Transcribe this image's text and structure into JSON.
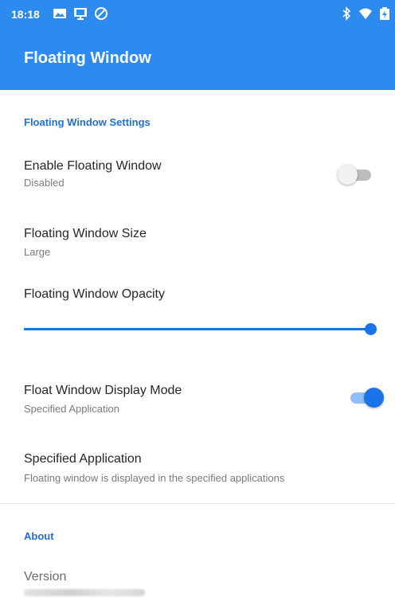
{
  "status_bar": {
    "time": "18:18",
    "left_icons": [
      "image-icon",
      "cast-icon",
      "sync-icon"
    ],
    "right_icons": [
      "bluetooth-icon",
      "wifi-icon",
      "battery-icon"
    ]
  },
  "toolbar": {
    "title": "Floating Window"
  },
  "sections": {
    "settings_title": "Floating Window Settings",
    "about_title": "About"
  },
  "prefs": {
    "enable": {
      "title": "Enable Floating Window",
      "summary": "Disabled",
      "checked": false
    },
    "size": {
      "title": "Floating Window Size",
      "summary": "Large"
    },
    "opacity": {
      "title": "Floating Window Opacity",
      "value_fraction": 0.99
    },
    "display_mode": {
      "title": "Float Window Display Mode",
      "summary": "Specified Application",
      "checked": true
    },
    "specified_app": {
      "title": "Specified Application",
      "summary": "Floating window is displayed in the specified applications"
    },
    "version": {
      "title": "Version"
    }
  },
  "colors": {
    "primary": "#2d8bf0",
    "accent": "#1b73e8",
    "section_text": "#1f6fd6"
  }
}
